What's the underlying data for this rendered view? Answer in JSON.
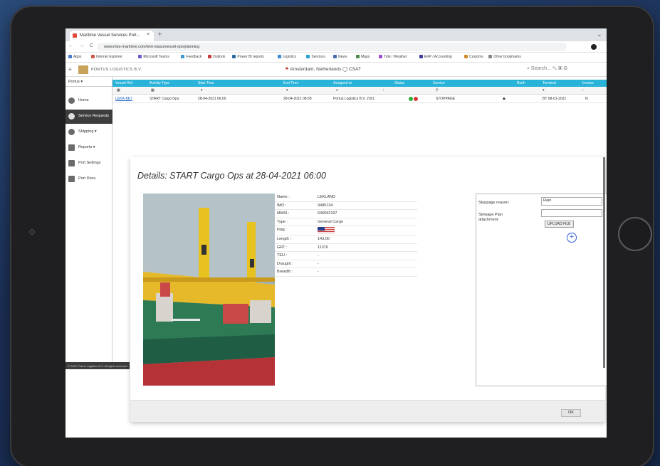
{
  "browser": {
    "tab_title": "Maritime Vessel Services Port...",
    "new_tab": "+",
    "window_menu": "⌄",
    "nav": "← → C",
    "url": "www.ntes-maritime.com/tem-stasu/vessel-ops/planning",
    "bookmarks": [
      {
        "label": "Apps",
        "color": "#4a7bd0"
      },
      {
        "label": "Internet Explorer",
        "color": "#d05a4a"
      },
      {
        "label": "Microsoft Teams",
        "color": "#6a5ad0"
      },
      {
        "label": "Feedback",
        "color": "#3a9ad0"
      },
      {
        "label": "Outlook",
        "color": "#c83a3a"
      },
      {
        "label": "Power BI reports",
        "color": "#2a6aa0"
      },
      {
        "label": "Logistics",
        "color": "#3a8ad0"
      },
      {
        "label": "Services",
        "color": "#2aa0d0"
      },
      {
        "label": "News",
        "color": "#4a6ab0"
      },
      {
        "label": "Maps",
        "color": "#4a8a4a"
      },
      {
        "label": "Tide / Weather",
        "color": "#a04ad0"
      },
      {
        "label": "ERP / Accounting",
        "color": "#3a3a9a"
      },
      {
        "label": "Customs",
        "color": "#d08a2a"
      },
      {
        "label": "Other bookmarks",
        "color": "#888888"
      }
    ]
  },
  "app": {
    "brand": "PORTUS LOGISTICS B.V.",
    "location": "Amsterdam, Netherlands",
    "user": "CSAT",
    "tools": "⌕ Search...   ✎  ▣  ⚙"
  },
  "sidebar": {
    "top_label": "Portus ▾",
    "items": [
      {
        "label": "Home"
      },
      {
        "label": "Service Requests"
      },
      {
        "label": "Shipping ▾"
      },
      {
        "label": "Reports ▾"
      },
      {
        "label": "Port Settings"
      },
      {
        "label": "Port Docs"
      }
    ],
    "footer": "© 2021 Portus Logistics B.V. All rights reserved"
  },
  "grid": {
    "columns": [
      "Vessel Ref.",
      "Activity Type",
      "Start Time",
      "End Time",
      "Assigned to",
      "Status",
      "Service",
      "Berth",
      "Terminal",
      "Invoice"
    ],
    "filters": [
      "▦",
      "▦",
      "▾",
      "▾",
      "≡",
      "⁝",
      "⚲",
      "▾",
      "⁝"
    ],
    "row": {
      "ref": "LEKA-BE7",
      "activity": "START Cargo Ops",
      "start": "28-04-2021 06:00",
      "end": "28-04-2021 08:00",
      "assigned": "Portus Logistics B.V. 2021",
      "service": "STOPPAGE",
      "icon": "◆",
      "berth": "BT 08-01-2021",
      "invoice": "N"
    }
  },
  "dialog": {
    "title": "Details: START Cargo Ops at 28-04-2021 06:00",
    "vessel": [
      {
        "label": "Name :",
        "value": "LEKLAND"
      },
      {
        "label": "IMO :",
        "value": "9480134"
      },
      {
        "label": "MMSI :",
        "value": "636092197"
      },
      {
        "label": "Type :",
        "value": "General Cargo"
      },
      {
        "label": "Flag :",
        "value": ""
      },
      {
        "label": "Length :",
        "value": "143.00"
      },
      {
        "label": "GRT :",
        "value": "11376"
      },
      {
        "label": "TEU :",
        "value": "-"
      },
      {
        "label": "Draught :",
        "value": "-"
      },
      {
        "label": "Breadth :",
        "value": "-"
      }
    ],
    "stoppage": {
      "reason_label": "Stoppage reason:",
      "reason_value": "Rain",
      "plan_label": "Stowage Plan attachment:",
      "plan_value": "",
      "upload_label": "UPLOAD FILE"
    },
    "ok_label": "OK"
  },
  "colors": {
    "grid_header": "#29b3d9",
    "remove_red": "#e03a3a",
    "add_blue": "#2d5bd8",
    "status_green": "#2fae3a",
    "status_red": "#d93636"
  }
}
